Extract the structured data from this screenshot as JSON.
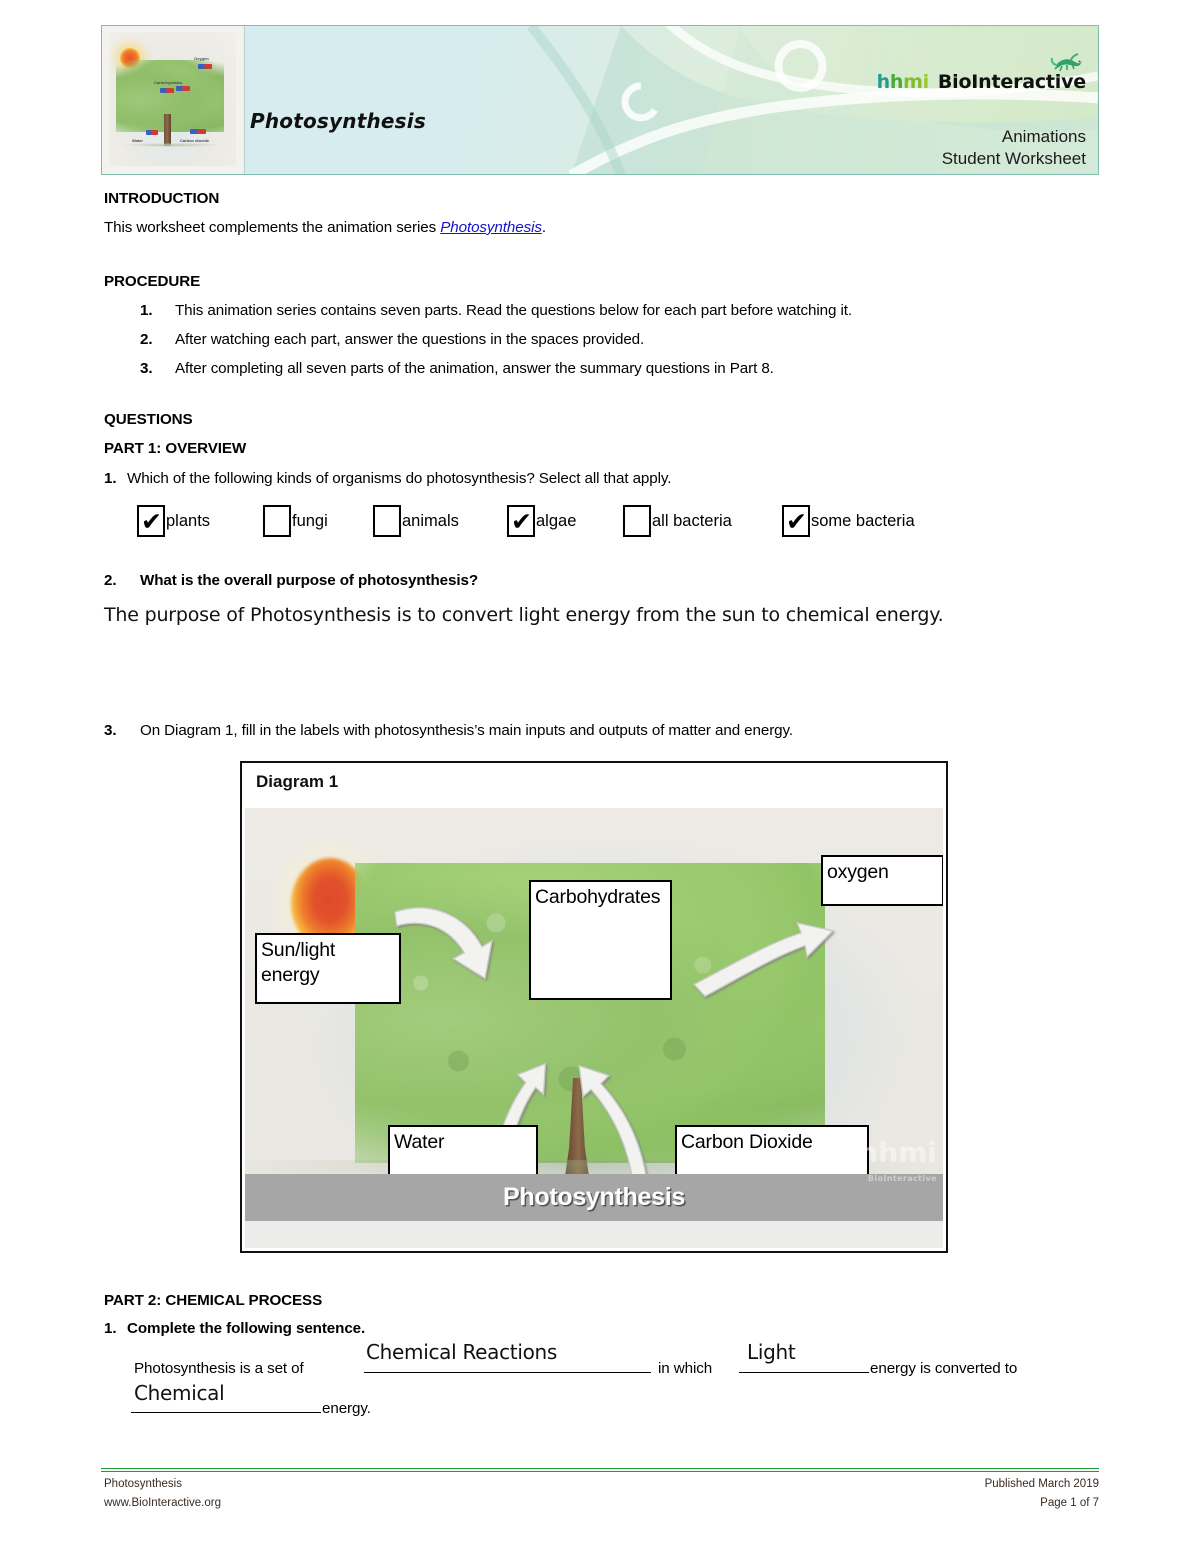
{
  "header": {
    "title": "Photosynthesis",
    "logo_hhmi": "hhmi",
    "logo_bio": "BioInteractive",
    "sub_line1": "Animations",
    "sub_line2": "Student Worksheet",
    "thumb_labels": {
      "sun": "Sunlight",
      "carbs": "Carbohydrates",
      "oxygen": "Oxygen",
      "water": "Water",
      "co2": "Carbon dioxide"
    }
  },
  "intro": {
    "heading": "INTRODUCTION",
    "text_before": "This worksheet complements the animation series ",
    "link": "Photosynthesis",
    "text_after": "."
  },
  "procedure": {
    "heading": "PROCEDURE",
    "items": [
      {
        "num": "1.",
        "text": "This animation series contains seven parts. Read the questions below for each part before watching it."
      },
      {
        "num": "2.",
        "text": "After watching each part, answer the questions in the spaces provided."
      },
      {
        "num": "3.",
        "text": "After completing all seven parts of the animation, answer the summary questions in Part 8."
      }
    ]
  },
  "questions": {
    "heading": "QUESTIONS",
    "part1_heading": "PART 1: OVERVIEW",
    "q1": {
      "num": "1.",
      "text": "Which of the following kinds of organisms do photosynthesis? Select all that apply.",
      "options": [
        {
          "label": "plants",
          "checked": true,
          "mark": "✔"
        },
        {
          "label": "fungi",
          "checked": false,
          "mark": ""
        },
        {
          "label": "animals",
          "checked": false,
          "mark": ""
        },
        {
          "label": "algae",
          "checked": true,
          "mark": "✔"
        },
        {
          "label": "all bacteria",
          "checked": false,
          "mark": ""
        },
        {
          "label": "some bacteria",
          "checked": true,
          "mark": "✔"
        }
      ]
    },
    "q2": {
      "num": "2.",
      "text": "What is the overall purpose of photosynthesis?",
      "answer": "The purpose of Photosynthesis is to convert light energy from the sun to chemical energy."
    },
    "q3": {
      "num": "3.",
      "text": "On Diagram 1, fill in the labels with photosynthesis’s main inputs and outputs of matter and energy."
    }
  },
  "diagram": {
    "title": "Diagram 1",
    "caption": "Photosynthesis",
    "watermark": "hhmi",
    "watermark_sub": "BioInteractive",
    "labels": {
      "sun": "Sun/light energy",
      "carbohydrates": "Carbohydrates",
      "oxygen": "oxygen",
      "water": "Water",
      "carbon_dioxide": "Carbon Dioxide"
    }
  },
  "part2": {
    "heading": "PART 2: CHEMICAL PROCESS",
    "q1_num": "1.",
    "q1_text": "Complete the following sentence.",
    "sentence": {
      "seg1": "Photosynthesis is a set of",
      "blank1": "Chemical Reactions",
      "seg2": "in which",
      "blank2": "Light",
      "seg3": "energy is converted to",
      "blank3": "Chemical",
      "seg4": "energy."
    }
  },
  "footer": {
    "left_line1": "Photosynthesis",
    "left_line2": "www.BioInteractive.org",
    "right_line1": "Published March 2019",
    "right_line2": "Page 1 of 7",
    "rule_color": "#17a02c"
  }
}
